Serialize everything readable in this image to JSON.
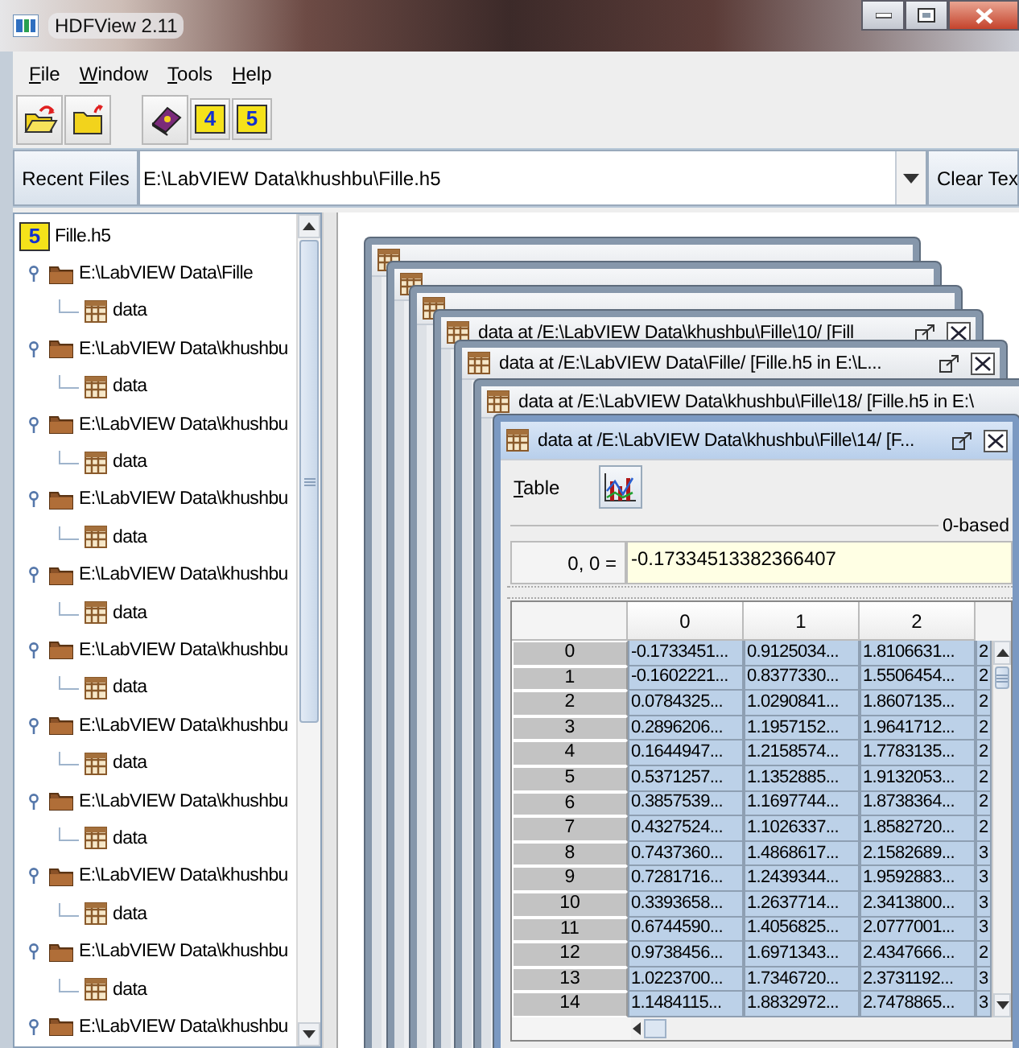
{
  "window": {
    "title": "HDFView 2.11"
  },
  "menu": [
    "File",
    "Window",
    "Tools",
    "Help"
  ],
  "toolbar": [
    {
      "kind": "open"
    },
    {
      "kind": "close"
    },
    {
      "kind": "help"
    },
    {
      "kind": "h4",
      "label": "4"
    },
    {
      "kind": "h5",
      "label": "5"
    }
  ],
  "recent_files": {
    "label": "Recent Files",
    "value": "E:\\LabVIEW Data\\khushbu\\Fille.h5",
    "clear_button": "Clear Tex"
  },
  "tree": {
    "badge": "5",
    "label": "Fille.h5",
    "children": [
      {
        "label": "E:\\LabVIEW Data\\Fille",
        "children": [
          {
            "label": "data"
          }
        ]
      },
      {
        "label": "E:\\LabVIEW Data\\khushbu",
        "children": [
          {
            "label": "data"
          }
        ]
      },
      {
        "label": "E:\\LabVIEW Data\\khushbu",
        "children": [
          {
            "label": "data"
          }
        ]
      },
      {
        "label": "E:\\LabVIEW Data\\khushbu",
        "children": [
          {
            "label": "data"
          }
        ]
      },
      {
        "label": "E:\\LabVIEW Data\\khushbu",
        "children": [
          {
            "label": "data"
          }
        ]
      },
      {
        "label": "E:\\LabVIEW Data\\khushbu",
        "children": [
          {
            "label": "data"
          }
        ]
      },
      {
        "label": "E:\\LabVIEW Data\\khushbu",
        "children": [
          {
            "label": "data"
          }
        ]
      },
      {
        "label": "E:\\LabVIEW Data\\khushbu",
        "children": [
          {
            "label": "data"
          }
        ]
      },
      {
        "label": "E:\\LabVIEW Data\\khushbu",
        "children": [
          {
            "label": "data"
          }
        ]
      },
      {
        "label": "E:\\LabVIEW Data\\khushbu",
        "children": [
          {
            "label": "data"
          }
        ]
      },
      {
        "label": "E:\\LabVIEW Data\\khushbu"
      }
    ]
  },
  "data_windows": [
    {
      "active": false,
      "buttons": false
    },
    {
      "active": false,
      "buttons": false
    },
    {
      "active": false,
      "buttons": false
    },
    {
      "title": "data at /E:\\LabVIEW Data\\khushbu\\Fille\\10/ [Fill",
      "active": false,
      "buttons": true
    },
    {
      "title": "data at /E:\\LabVIEW Data\\Fille/ [Fille.h5 in E:\\L...",
      "active": false,
      "buttons": true
    },
    {
      "title": "data at /E:\\LabVIEW Data\\khushbu\\Fille\\18/ [Fille.h5 in E:\\",
      "active": false,
      "buttons": false
    },
    {
      "title": "data at /E:\\LabVIEW Data\\khushbu\\Fille\\14/ [F...",
      "active": true,
      "buttons": true
    }
  ],
  "table_view": {
    "menu": "Table",
    "locator": "0-based",
    "cell_label": "0, 0 =",
    "cell_value": "-0.17334513382366407",
    "columns": [
      "0",
      "1",
      "2"
    ],
    "rows": [
      {
        "index": "0",
        "selected": true,
        "cells": [
          "-0.1733451...",
          "0.9125034...",
          "1.8106631...",
          "2"
        ]
      },
      {
        "index": "1",
        "selected": true,
        "cells": [
          "-0.1602221...",
          "0.8377330...",
          "1.5506454...",
          "2"
        ]
      },
      {
        "index": "2",
        "selected": true,
        "cells": [
          "0.0784325...",
          "1.0290841...",
          "1.8607135...",
          "2"
        ]
      },
      {
        "index": "3",
        "selected": true,
        "cells": [
          "0.2896206...",
          "1.1957152...",
          "1.9641712...",
          "2"
        ]
      },
      {
        "index": "4",
        "selected": true,
        "cells": [
          "0.1644947...",
          "1.2158574...",
          "1.7783135...",
          "2"
        ]
      },
      {
        "index": "5",
        "selected": true,
        "cells": [
          "0.5371257...",
          "1.1352885...",
          "1.9132053...",
          "2"
        ]
      },
      {
        "index": "6",
        "selected": true,
        "cells": [
          "0.3857539...",
          "1.1697744...",
          "1.8738364...",
          "2"
        ]
      },
      {
        "index": "7",
        "selected": true,
        "cells": [
          "0.4327524...",
          "1.1026337...",
          "1.8582720...",
          "2"
        ]
      },
      {
        "index": "8",
        "selected": true,
        "cells": [
          "0.7437360...",
          "1.4868617...",
          "2.1582689...",
          "3"
        ]
      },
      {
        "index": "9",
        "selected": true,
        "cells": [
          "0.7281716...",
          "1.2439344...",
          "1.9592883...",
          "3"
        ]
      },
      {
        "index": "10",
        "selected": true,
        "cells": [
          "0.3393658...",
          "1.2637714...",
          "2.3413800...",
          "3"
        ]
      },
      {
        "index": "11",
        "selected": true,
        "cells": [
          "0.6744590...",
          "1.4056825...",
          "2.0777001...",
          "3"
        ]
      },
      {
        "index": "12",
        "selected": true,
        "cells": [
          "0.9738456...",
          "1.6971343...",
          "2.4347666...",
          "2"
        ]
      },
      {
        "index": "13",
        "selected": true,
        "cells": [
          "1.0223700...",
          "1.7346720...",
          "2.3731192...",
          "3"
        ]
      },
      {
        "index": "14",
        "selected": true,
        "cells": [
          "1.1484115...",
          "1.8832972...",
          "2.7478865...",
          "3"
        ]
      }
    ]
  }
}
